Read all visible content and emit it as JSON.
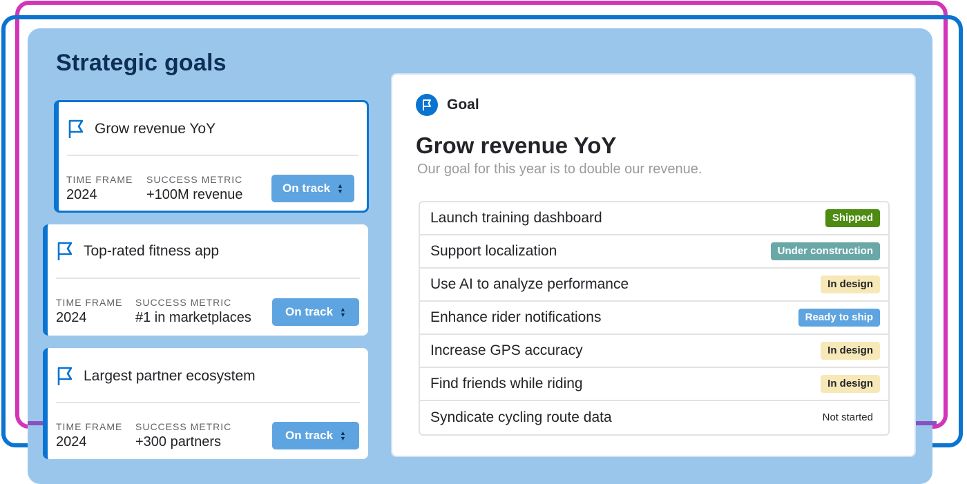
{
  "panel": {
    "title": "Strategic goals"
  },
  "goals": [
    {
      "title": "Grow revenue YoY",
      "time_frame_label": "TIME FRAME",
      "time_frame": "2024",
      "metric_label": "SUCCESS METRIC",
      "metric": "+100M revenue",
      "status": "On track",
      "selected": true
    },
    {
      "title": "Top-rated fitness app",
      "time_frame_label": "TIME FRAME",
      "time_frame": "2024",
      "metric_label": "SUCCESS METRIC",
      "metric": "#1 in marketplaces",
      "status": "On track",
      "selected": false
    },
    {
      "title": "Largest partner ecosystem",
      "time_frame_label": "TIME FRAME",
      "time_frame": "2024",
      "metric_label": "SUCCESS METRIC",
      "metric": "+300 partners",
      "status": "On track",
      "selected": false
    }
  ],
  "detail": {
    "type_label": "Goal",
    "type_icon": "flag-icon",
    "title": "Grow revenue YoY",
    "description": "Our goal for this year is to double our revenue.",
    "tasks": [
      {
        "name": "Launch training dashboard",
        "status": "Shipped",
        "bg": "#4d8b12",
        "fg": "#ffffff"
      },
      {
        "name": "Support localization",
        "status": "Under construction",
        "bg": "#6aa8a8",
        "fg": "#ffffff"
      },
      {
        "name": "Use AI to analyze performance",
        "status": "In design",
        "bg": "#f7e8b8",
        "fg": "#222428"
      },
      {
        "name": "Enhance rider notifications",
        "status": "Ready to ship",
        "bg": "#5ea4e0",
        "fg": "#ffffff"
      },
      {
        "name": "Increase GPS accuracy",
        "status": "In design",
        "bg": "#f7e8b8",
        "fg": "#222428"
      },
      {
        "name": "Find friends while riding",
        "status": "In design",
        "bg": "#f7e8b8",
        "fg": "#222428"
      },
      {
        "name": "Syndicate cycling route data",
        "status": "Not started",
        "bg": "transparent",
        "fg": "#222428"
      }
    ]
  },
  "colors": {
    "accent": "#0a74d0",
    "panel_bg": "#9bc6ec",
    "status_button": "#5ea4e0",
    "outline_pink": "#d235b8",
    "title_navy": "#0d2f55"
  }
}
